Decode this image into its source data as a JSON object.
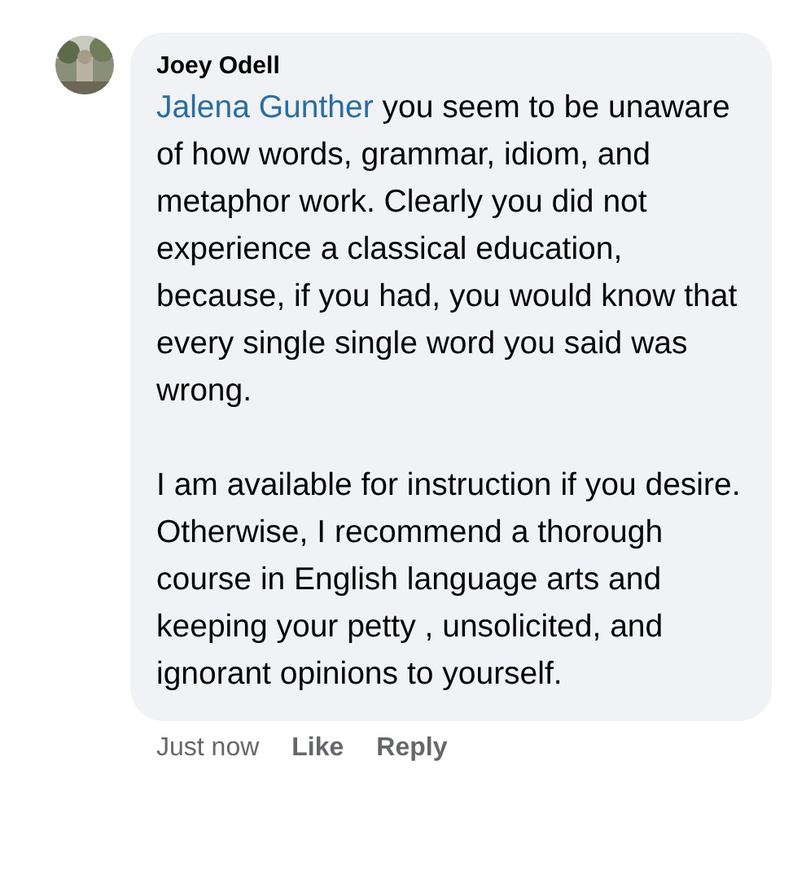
{
  "comment": {
    "author": "Joey Odell",
    "mention": "Jalena Gunther",
    "paragraphs": [
      "you seem to be unaware of how words, grammar, idiom, and metaphor work. Clearly you did not experience a classical education, because, if you had, you would know that every single single word you said was wrong.",
      "I am available for instruction if you desire.  Otherwise, I recommend a thorough course in English language arts and keeping your petty , unsolicited, and ignorant opinions to yourself."
    ]
  },
  "footer": {
    "time": "Just now",
    "actions": [
      "Like",
      "Reply"
    ]
  }
}
